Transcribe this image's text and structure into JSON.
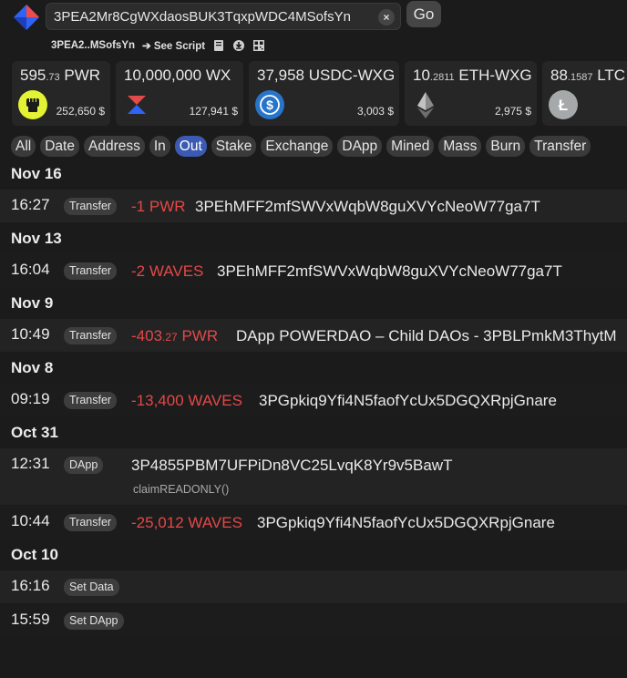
{
  "search": {
    "value": "3PEA2Mr8CgWXdaosBUK3TqxpWDC4MSofsYn"
  },
  "buttons": {
    "clear": "×",
    "go": "Go"
  },
  "subline": {
    "address_short": "3PEA2..MSofsYn",
    "see_script": "➔ See Script"
  },
  "assets": [
    {
      "amount_int": "595",
      "amount_dec": ".73",
      "ticker": "PWR",
      "usd": "252,650 $",
      "icon": "fist-icon",
      "color": "#e3f233"
    },
    {
      "amount_int": "10,000,000",
      "amount_dec": "",
      "ticker": "WX",
      "usd": "127,941 $",
      "icon": "wx-icon",
      "color": "#e34a4a"
    },
    {
      "amount_int": "37,958",
      "amount_dec": "",
      "ticker": "USDC-WXG",
      "usd": "3,003 $",
      "icon": "usdc-icon",
      "color": "#2775ca"
    },
    {
      "amount_int": "10",
      "amount_dec": ".2811",
      "ticker": "ETH-WXG",
      "usd": "2,975 $",
      "icon": "eth-icon",
      "color": "#8a8a8a"
    },
    {
      "amount_int": "88",
      "amount_dec": ".1587",
      "ticker": "LTC",
      "usd": "",
      "icon": "ltc-icon",
      "color": "#a6a9aa"
    }
  ],
  "filters": [
    "All",
    "Date",
    "Address",
    "In",
    "Out",
    "Stake",
    "Exchange",
    "DApp",
    "Mined",
    "Mass",
    "Burn",
    "Transfer"
  ],
  "active_filter": "Out",
  "groups": [
    {
      "date": "Nov 16",
      "rows": [
        {
          "time": "16:27",
          "tag": "Transfer",
          "amount_int": "-1",
          "amount_dec": "",
          "ticker": "PWR",
          "target": "3PEhMFF2mfSWVxWqbW8guXVYcNeoW77ga7T"
        }
      ]
    },
    {
      "date": "Nov 13",
      "rows": [
        {
          "time": "16:04",
          "tag": "Transfer",
          "amount_int": "-2",
          "amount_dec": "",
          "ticker": "WAVES",
          "target": "3PEhMFF2mfSWVxWqbW8guXVYcNeoW77ga7T"
        }
      ]
    },
    {
      "date": "Nov 9",
      "rows": [
        {
          "time": "10:49",
          "tag": "Transfer",
          "amount_int": "-403",
          "amount_dec": ".27",
          "ticker": "PWR",
          "target": "DApp POWERDAO – Child DAOs - 3PBLPmkM3ThytM"
        }
      ]
    },
    {
      "date": "Nov 8",
      "rows": [
        {
          "time": "09:19",
          "tag": "Transfer",
          "amount_int": "-13,400",
          "amount_dec": "",
          "ticker": "WAVES",
          "target": "3PGpkiq9Yfi4N5faofYcUx5DGQXRpjGnare"
        }
      ]
    },
    {
      "date": "Oct 31",
      "rows": [
        {
          "time": "12:31",
          "tag": "DApp",
          "amount_int": "",
          "amount_dec": "",
          "ticker": "",
          "target": "3P4855PBM7UFPiDn8VC25LvqK8Yr9v5BawT",
          "call": "claimREADONLY()"
        },
        {
          "time": "10:44",
          "tag": "Transfer",
          "amount_int": "-25,012",
          "amount_dec": "",
          "ticker": "WAVES",
          "target": "3PGpkiq9Yfi4N5faofYcUx5DGQXRpjGnare"
        }
      ]
    },
    {
      "date": "Oct 10",
      "rows": [
        {
          "time": "16:16",
          "tag": "Set Data",
          "amount_int": "",
          "amount_dec": "",
          "ticker": "",
          "target": ""
        },
        {
          "time": "15:59",
          "tag": "Set DApp",
          "amount_int": "",
          "amount_dec": "",
          "ticker": "",
          "target": ""
        }
      ]
    }
  ]
}
